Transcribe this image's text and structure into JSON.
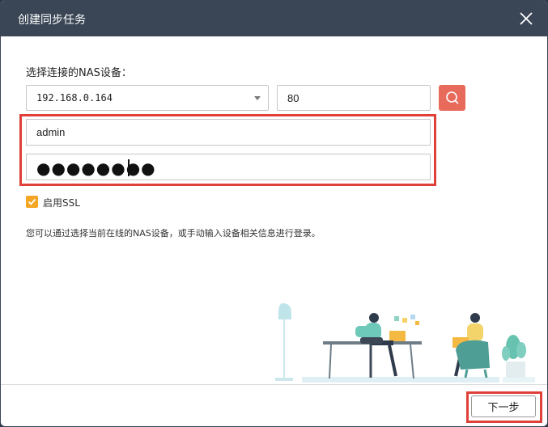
{
  "dialog": {
    "title": "创建同步任务",
    "prompt": "选择连接的NAS设备：",
    "device": {
      "selected_ip": "192.168.0.164",
      "port": "80"
    },
    "credentials": {
      "username": "admin",
      "password_mask": "●●●●●●●●"
    },
    "ssl": {
      "label": "启用SSL",
      "checked": true
    },
    "info_text": "您可以通过选择当前在线的NAS设备，或手动输入设备相关信息进行登录。",
    "next_label": "下一步"
  },
  "colors": {
    "titlebar": "#3a4656",
    "search_button": "#e86a5a",
    "checkbox": "#f5a623",
    "highlight": "#e0403a"
  },
  "icons": {
    "close": "close-icon",
    "search": "search-icon",
    "check": "check-icon",
    "dropdown": "chevron-down-icon"
  }
}
